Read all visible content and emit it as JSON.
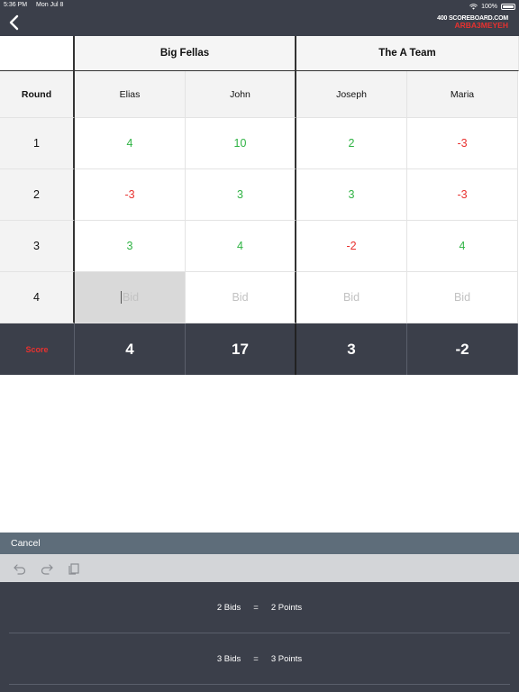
{
  "status_bar": {
    "time": "5:36 PM",
    "date": "Mon Jul 8",
    "battery": "100%"
  },
  "brand": {
    "line1": "400 SCOREBOARD.COM",
    "line2": "ARBA3MEYEH"
  },
  "teams": [
    {
      "name": "Big Fellas"
    },
    {
      "name": "The A Team"
    }
  ],
  "header": {
    "round_label": "Round",
    "players": [
      "Elias",
      "John",
      "Joseph",
      "Maria"
    ]
  },
  "rounds": [
    {
      "number": "1",
      "values": [
        "4",
        "10",
        "2",
        "-3"
      ]
    },
    {
      "number": "2",
      "values": [
        "-3",
        "3",
        "3",
        "-3"
      ]
    },
    {
      "number": "3",
      "values": [
        "3",
        "4",
        "-2",
        "4"
      ]
    }
  ],
  "current_round": {
    "number": "4",
    "bid_placeholder": "Bid"
  },
  "score_row": {
    "label": "Score",
    "values": [
      "4",
      "17",
      "3",
      "-2"
    ]
  },
  "cancel_label": "Cancel",
  "picker_options": [
    {
      "bids": "2 Bids",
      "eq": "=",
      "points": "2 Points"
    },
    {
      "bids": "3 Bids",
      "eq": "=",
      "points": "3 Points"
    }
  ],
  "colors": {
    "header_bg": "#3b3f4a",
    "positive": "#2fb344",
    "negative": "#e8312f",
    "cancel_bar": "#5e6d7a",
    "toolbar": "#d3d5d8"
  },
  "icons": [
    "back-chevron-icon",
    "wifi-icon",
    "battery-icon",
    "undo-icon",
    "redo-icon",
    "clipboard-icon"
  ]
}
